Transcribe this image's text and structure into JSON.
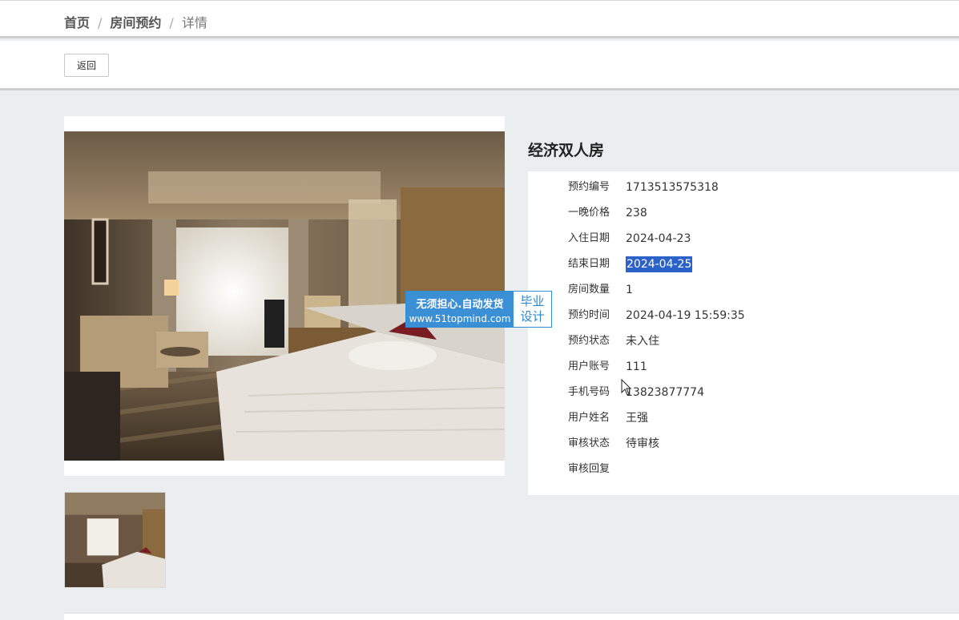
{
  "breadcrumb": {
    "home": "首页",
    "section": "房间预约",
    "current": "详情",
    "separator": "/"
  },
  "toolbar": {
    "back_label": "返回"
  },
  "room": {
    "title": "经济双人房",
    "fields": [
      {
        "label": "预约编号",
        "value": "1713513575318"
      },
      {
        "label": "一晚价格",
        "value": "238"
      },
      {
        "label": "入住日期",
        "value": "2024-04-23"
      },
      {
        "label": "结束日期",
        "value": "2024-04-25"
      },
      {
        "label": "房间数量",
        "value": "1"
      },
      {
        "label": "预约时间",
        "value": "2024-04-19 15:59:35"
      },
      {
        "label": "预约状态",
        "value": "未入住"
      },
      {
        "label": "用户账号",
        "value": "111"
      },
      {
        "label": "手机号码",
        "value": "13823877774"
      },
      {
        "label": "用户姓名",
        "value": "王强"
      },
      {
        "label": "审核状态",
        "value": "待审核"
      },
      {
        "label": "审核回复",
        "value": ""
      }
    ]
  },
  "watermark": {
    "line1": "无须担心.自动发货",
    "line2": "www.51topmind.com",
    "tag_top": "毕业",
    "tag_bottom": "设计"
  },
  "colors": {
    "selection": "#2a62c9",
    "watermark_blue": "#3b8fd4"
  }
}
